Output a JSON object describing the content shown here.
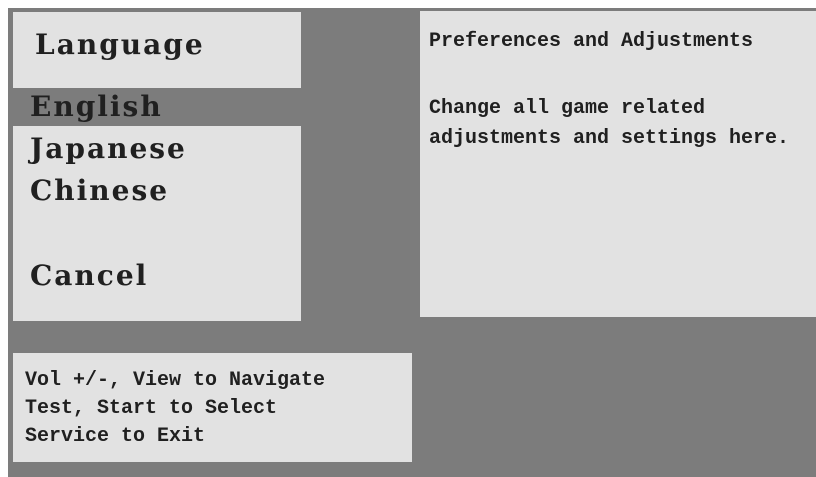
{
  "menu": {
    "title": "Language",
    "items": [
      {
        "label": "English",
        "selected": true
      },
      {
        "label": "Japanese",
        "selected": false
      },
      {
        "label": "Chinese",
        "selected": false
      },
      {
        "label": "Cancel",
        "selected": false
      }
    ]
  },
  "description": {
    "heading": "Preferences and Adjustments",
    "lines": [
      "Change all game related",
      "adjustments and settings here."
    ]
  },
  "help": {
    "lines": [
      "Vol +/-, View to Navigate",
      "Test, Start to Select",
      "Service to Exit"
    ]
  },
  "colors": {
    "background": "#7c7c7c",
    "panel": "#e2e2e2",
    "selection_highlight": "#7c7c7c",
    "text": "#202020"
  }
}
